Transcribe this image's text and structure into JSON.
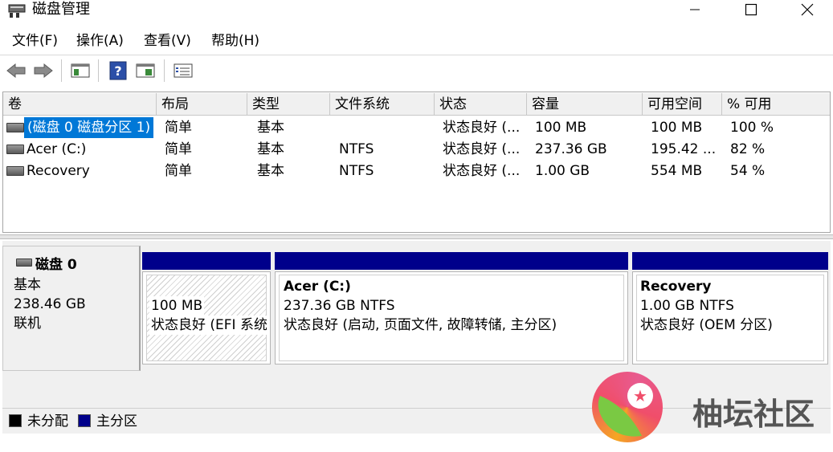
{
  "window": {
    "title": "磁盘管理",
    "buttons": {
      "minimize": "—",
      "maximize": "☐",
      "close": "✕"
    }
  },
  "menu": [
    "文件(F)",
    "操作(A)",
    "查看(V)",
    "帮助(H)"
  ],
  "toolbar": {
    "icons": [
      "back-arrow-icon",
      "forward-arrow-icon",
      "console-tree-icon",
      "help-icon",
      "properties-icon",
      "checklist-icon"
    ],
    "help_glyph": "?"
  },
  "volume_table": {
    "columns": [
      "卷",
      "布局",
      "类型",
      "文件系统",
      "状态",
      "容量",
      "可用空间",
      "% 可用"
    ],
    "rows": [
      [
        "(磁盘 0 磁盘分区 1)",
        "简单",
        "基本",
        "",
        "状态良好 (...",
        "100 MB",
        "100 MB",
        "100 %"
      ],
      [
        "Acer (C:)",
        "简单",
        "基本",
        "NTFS",
        "状态良好 (...",
        "237.36 GB",
        "195.42 ...",
        "82 %"
      ],
      [
        "Recovery",
        "简单",
        "基本",
        "NTFS",
        "状态良好 (...",
        "1.00 GB",
        "554 MB",
        "54 %"
      ]
    ],
    "selected_row": 0
  },
  "disk": {
    "name": "磁盘 0",
    "type": "基本",
    "size": "238.46 GB",
    "status": "联机",
    "partitions": [
      {
        "title": "",
        "size": "100 MB",
        "status": "状态良好 (EFI 系统"
      },
      {
        "title": "Acer  (C:)",
        "size": "237.36 GB NTFS",
        "status": "状态良好 (启动, 页面文件, 故障转储, 主分区)"
      },
      {
        "title": "Recovery",
        "size": "1.00 GB NTFS",
        "status": "状态良好 (OEM 分区)"
      }
    ]
  },
  "legend": [
    {
      "label": "未分配",
      "color": "#000000"
    },
    {
      "label": "主分区",
      "color": "#00008b"
    }
  ],
  "colors": {
    "primary_partition": "#00008b",
    "selection": "#0078d7"
  },
  "watermark": {
    "text": "柚坛社区",
    "star": "★"
  }
}
